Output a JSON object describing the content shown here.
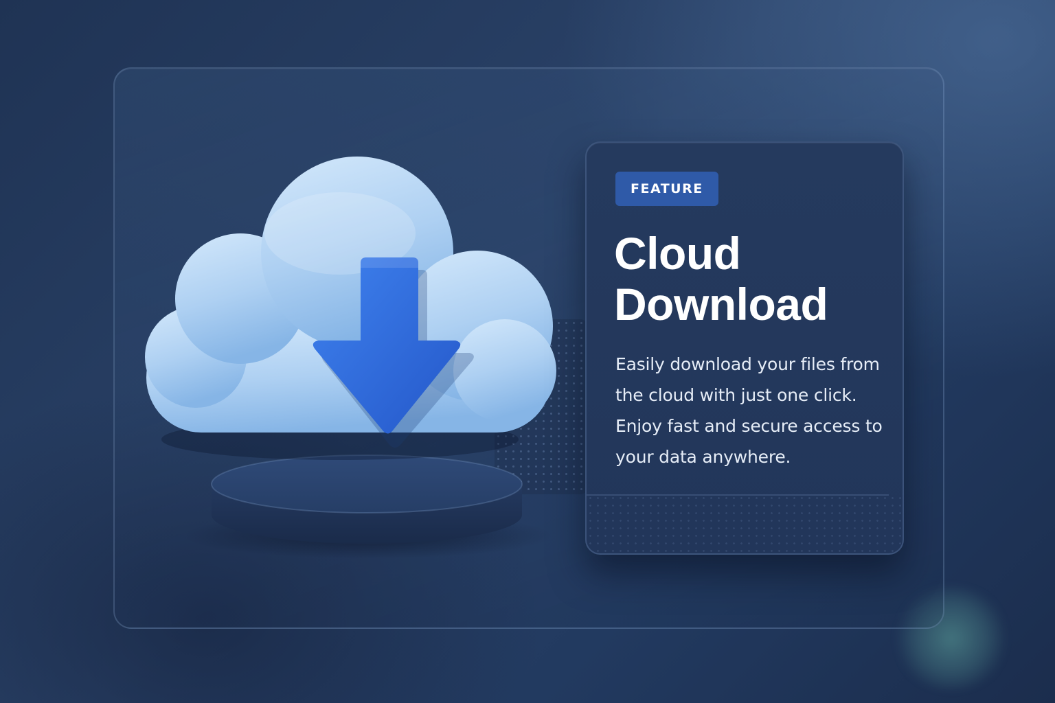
{
  "feature_card": {
    "badge": "FEATURE",
    "title": "Cloud Download",
    "description": "Easily download your files from the cloud with just one click. Enjoy fast and secure access to your data anywhere."
  },
  "illustration": {
    "icon": "cloud-download-icon",
    "colors": {
      "cloud": "#b9d8f5",
      "arrow": "#2f6fe0",
      "pedestal": "#2b4470"
    }
  },
  "colors": {
    "background": "#22385c",
    "card": "#243a5e",
    "badge": "#2f5aa8",
    "accent_glow": "#62aaa0"
  }
}
